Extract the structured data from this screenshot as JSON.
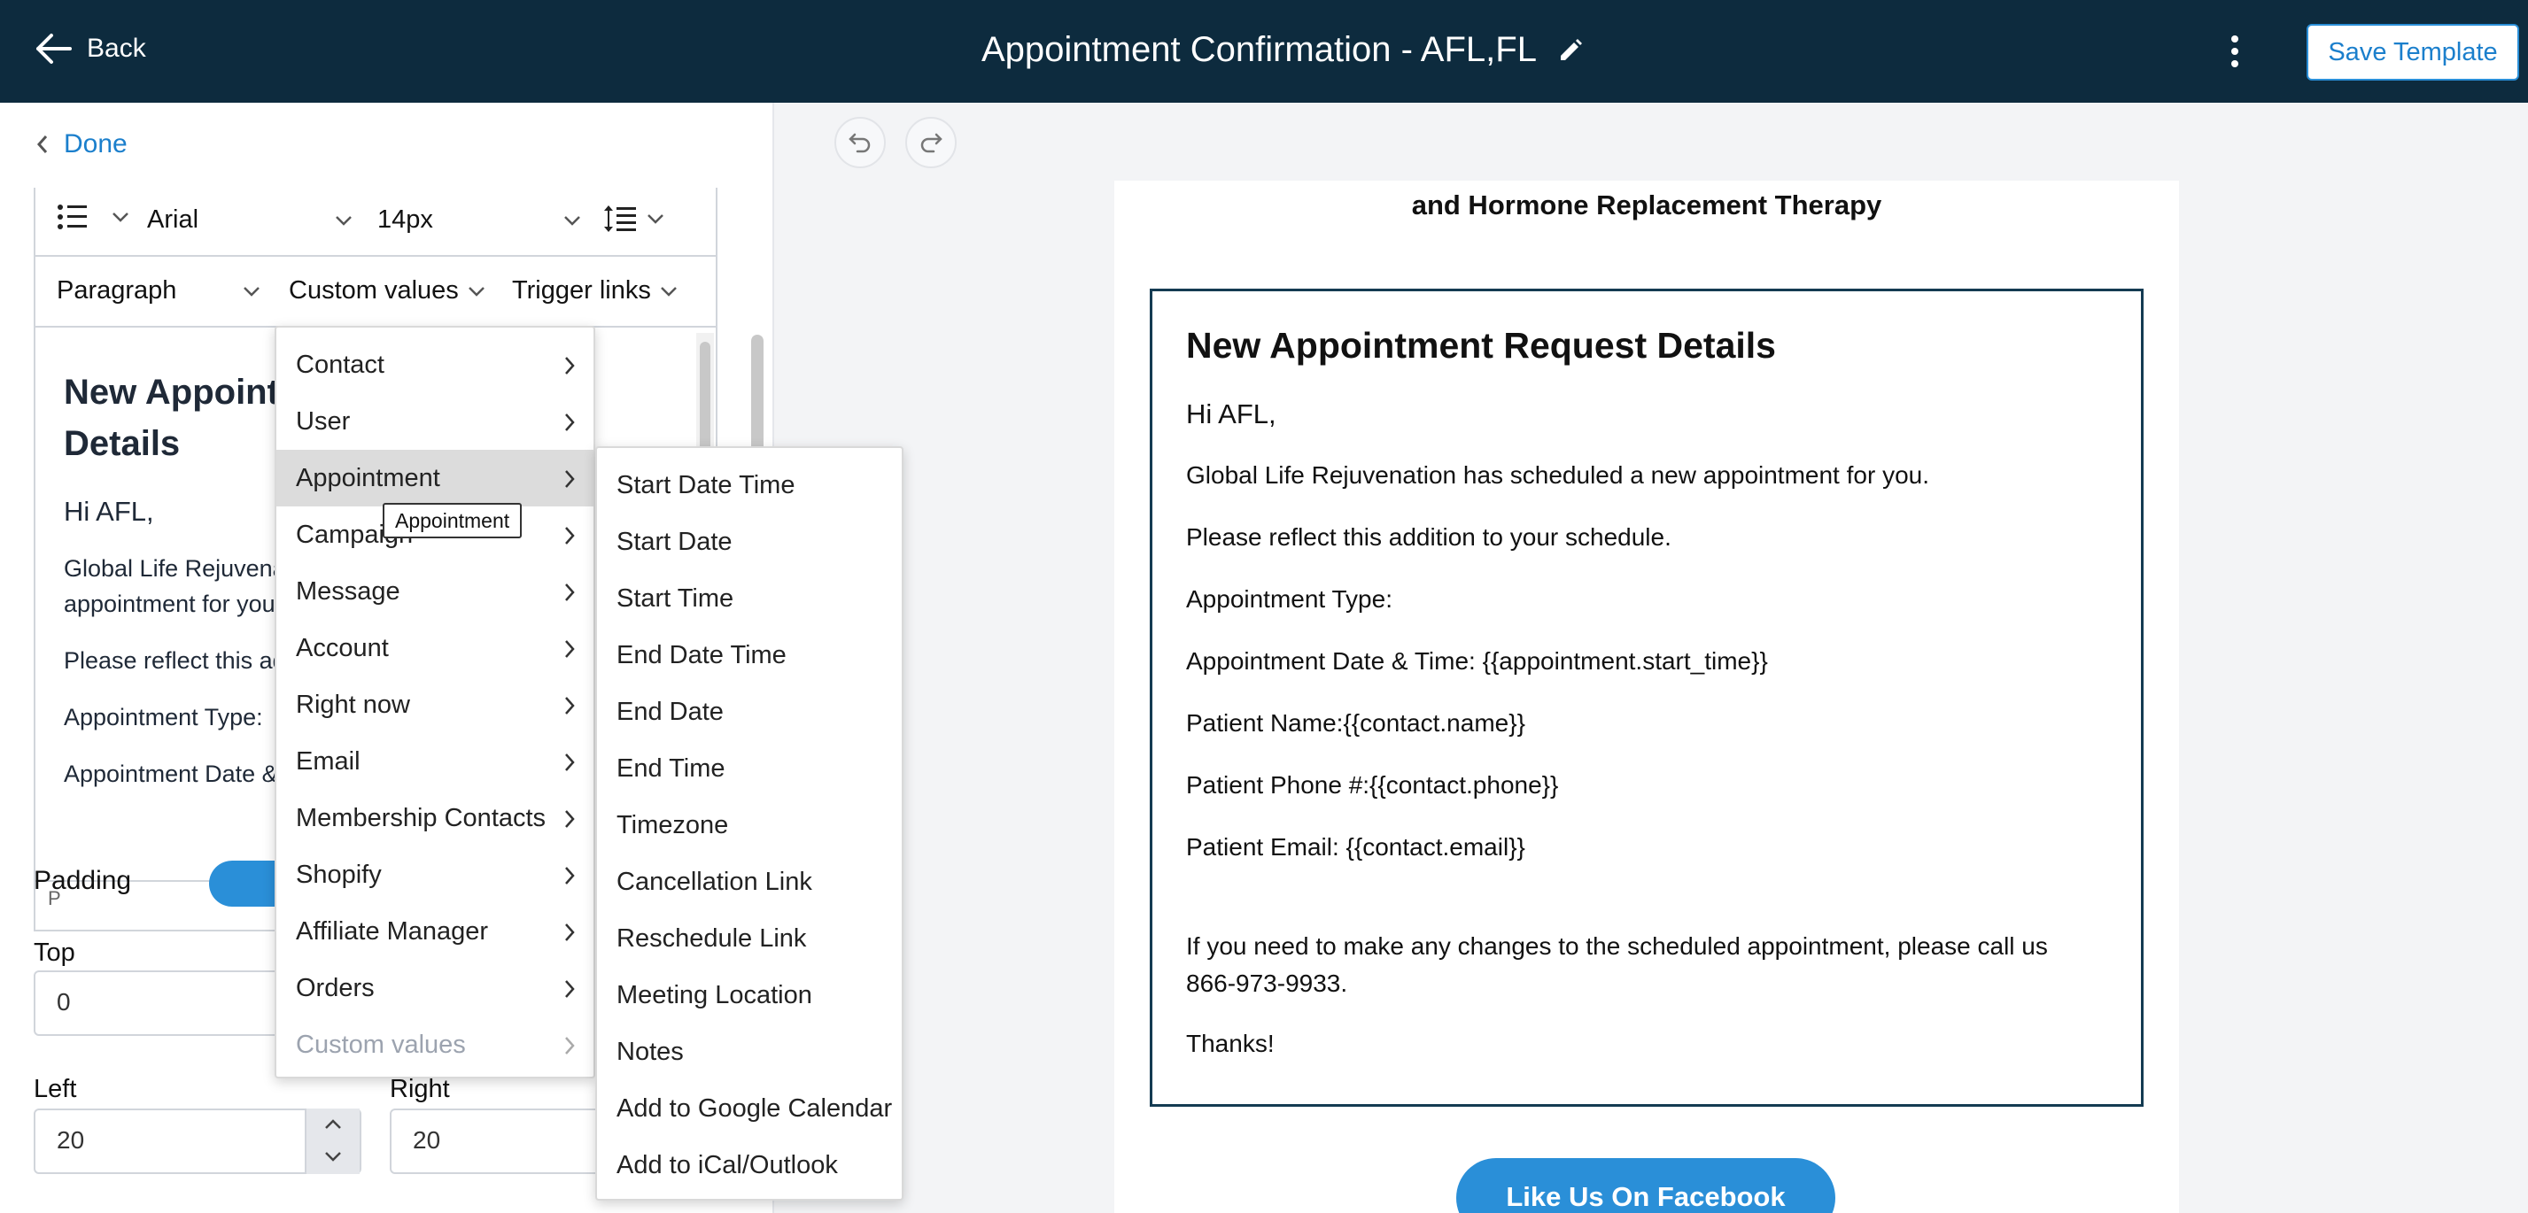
{
  "header": {
    "back_label": "Back",
    "title": "Appointment Confirmation - AFL,FL",
    "save_label": "Save Template"
  },
  "left_panel": {
    "done_label": "Done",
    "toolbar": {
      "font_family": "Arial",
      "font_size": "14px",
      "block_format": "Paragraph",
      "custom_values": "Custom values",
      "trigger_links": "Trigger links"
    },
    "editor": {
      "heading": "New Appointment Request Details",
      "greeting": "Hi AFL,",
      "p1": "Global Life Rejuvenation has scheduled a new appointment for you.",
      "p2": "Please reflect this addition to your schedule.",
      "p3": "Appointment Type:",
      "p4": "Appointment Date & Time:",
      "status_path": "P"
    },
    "padding": {
      "label": "Padding",
      "enabled": true,
      "top_label": "Top",
      "top_value": "0",
      "left_label": "Left",
      "left_value": "20",
      "right_label": "Right",
      "right_value": "20"
    }
  },
  "custom_values_menu": {
    "items": [
      "Contact",
      "User",
      "Appointment",
      "Campaign",
      "Message",
      "Account",
      "Right now",
      "Email",
      "Membership Contacts",
      "Shopify",
      "Affiliate Manager",
      "Orders",
      "Custom values"
    ],
    "active": "Appointment",
    "tooltip": "Appointment"
  },
  "appointment_submenu": {
    "items": [
      "Start Date Time",
      "Start Date",
      "Start Time",
      "End Date Time",
      "End Date",
      "End Time",
      "Timezone",
      "Cancellation Link",
      "Reschedule Link",
      "Meeting Location",
      "Notes",
      "Add to Google Calendar",
      "Add to iCal/Outlook"
    ]
  },
  "preview": {
    "subheading": "and Hormone Replacement Therapy",
    "card": {
      "heading": "New Appointment Request Details",
      "greeting": "Hi AFL,",
      "p1": "Global Life Rejuvenation has scheduled a new appointment for you.",
      "p2": "Please reflect this addition to your schedule.",
      "p3": "Appointment Type:",
      "p4": "Appointment Date & Time: {{appointment.start_time}}",
      "p5": "Patient Name:{{contact.name}}",
      "p6": "Patient Phone #:{{contact.phone}}",
      "p7": "Patient Email: {{contact.email}}",
      "p8_line1": "If you need to make any changes to the scheduled appointment, please call us",
      "p8_line2": "866-973-9933.",
      "p9": "Thanks!"
    },
    "facebook_button": "Like Us On Facebook"
  },
  "colors": {
    "header_bg": "#0d2b3e",
    "accent": "#2a8fd8",
    "card_border": "#143b52"
  }
}
